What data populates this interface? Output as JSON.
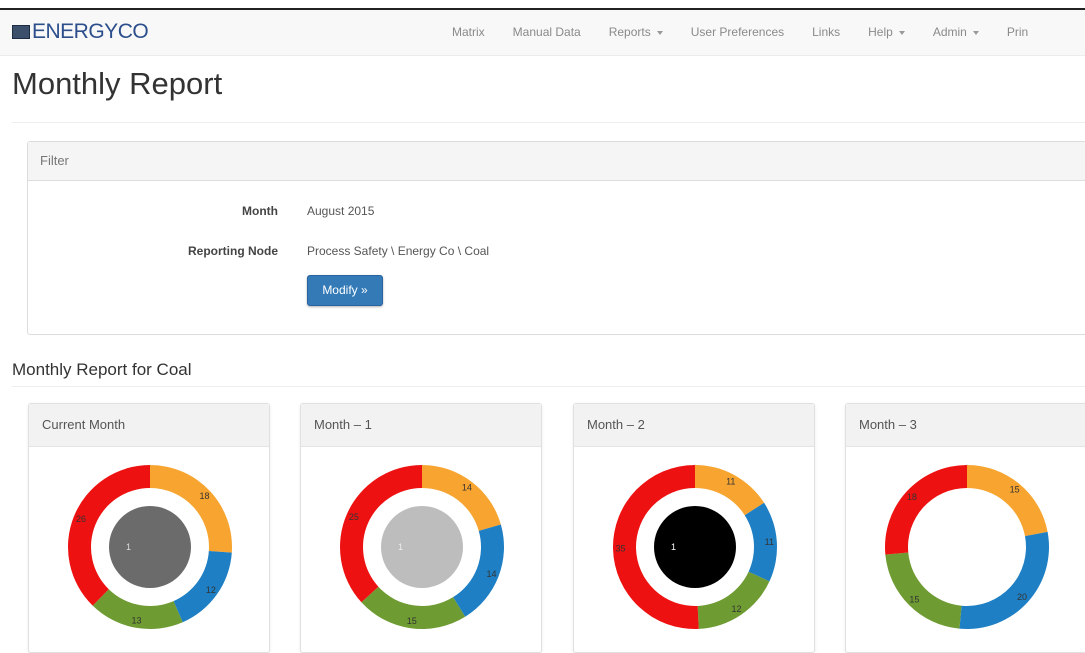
{
  "brand": {
    "name_part1": "ENERGY",
    "name_part2": "CO"
  },
  "nav": {
    "items": [
      {
        "label": "Matrix",
        "dropdown": false
      },
      {
        "label": "Manual Data",
        "dropdown": false
      },
      {
        "label": "Reports",
        "dropdown": true
      },
      {
        "label": "User Preferences",
        "dropdown": false
      },
      {
        "label": "Links",
        "dropdown": false
      },
      {
        "label": "Help",
        "dropdown": true
      },
      {
        "label": "Admin",
        "dropdown": true
      },
      {
        "label": "Prin",
        "dropdown": false
      }
    ]
  },
  "page": {
    "title": "Monthly Report"
  },
  "filter": {
    "heading": "Filter",
    "month_label": "Month",
    "month_value": "August 2015",
    "node_label": "Reporting Node",
    "node_value": "Process Safety \\ Energy Co \\ Coal",
    "modify_label": "Modify »"
  },
  "report": {
    "section_title": "Monthly Report for Coal"
  },
  "colors": {
    "red": "#ee1111",
    "orange": "#f7a530",
    "blue": "#1e7fc4",
    "green": "#6e9b32"
  },
  "cards": [
    {
      "title": "Current Month",
      "center_color": "#6b6b6b",
      "center_label": "1",
      "center_label_color": "#dddddd",
      "segments": [
        {
          "color": "orange",
          "value": 18
        },
        {
          "color": "blue",
          "value": 12
        },
        {
          "color": "green",
          "value": 13
        },
        {
          "color": "red",
          "value": 26
        }
      ]
    },
    {
      "title": "Month – 1",
      "center_color": "#bdbdbd",
      "center_label": "1",
      "center_label_color": "#eeeeee",
      "segments": [
        {
          "color": "orange",
          "value": 14
        },
        {
          "color": "blue",
          "value": 14
        },
        {
          "color": "green",
          "value": 15
        },
        {
          "color": "red",
          "value": 25
        }
      ]
    },
    {
      "title": "Month – 2",
      "center_color": "#000000",
      "center_label": "1",
      "center_label_color": "#ffffff",
      "segments": [
        {
          "color": "orange",
          "value": 11
        },
        {
          "color": "blue",
          "value": 11
        },
        {
          "color": "green",
          "value": 12
        },
        {
          "color": "red",
          "value": 35
        }
      ]
    },
    {
      "title": "Month – 3",
      "center_color": "",
      "center_label": "",
      "center_label_color": "",
      "segments": [
        {
          "color": "orange",
          "value": 15
        },
        {
          "color": "blue",
          "value": 20
        },
        {
          "color": "green",
          "value": 15
        },
        {
          "color": "red",
          "value": 18
        }
      ]
    }
  ]
}
